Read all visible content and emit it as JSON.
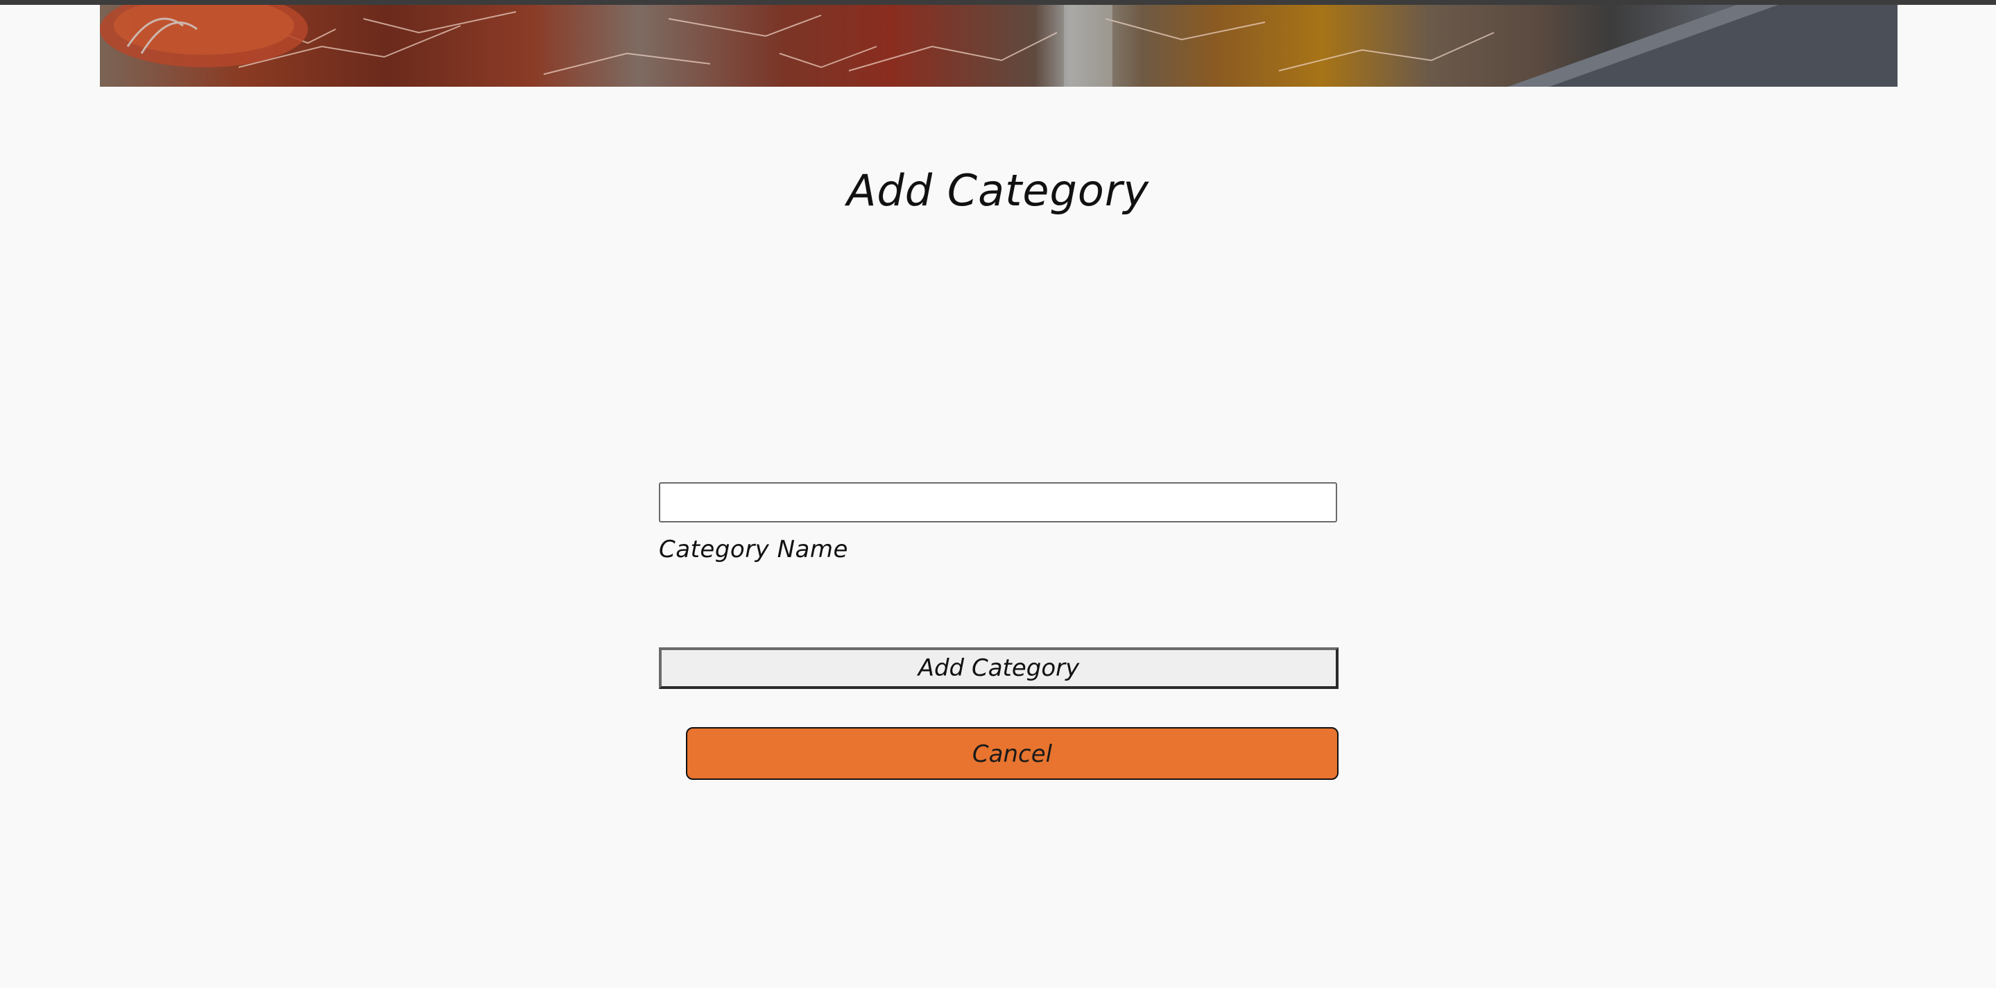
{
  "banner": {
    "description_icon": "marble-food-banner-image"
  },
  "page": {
    "title": "Add Category"
  },
  "form": {
    "category_name_value": "",
    "category_name_label": "Category Name",
    "submit_label": "Add Category",
    "cancel_label": "Cancel"
  },
  "colors": {
    "background": "#f9f9f9",
    "cancel_button": "#e8742f",
    "submit_button": "#efefef"
  }
}
